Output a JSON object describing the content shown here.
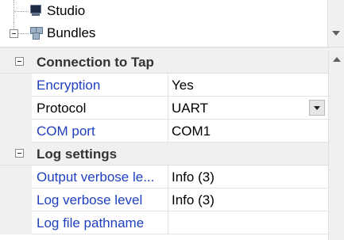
{
  "tree": {
    "items": [
      {
        "label": "Studio",
        "icon": "computer-icon"
      },
      {
        "label": "Bundles",
        "icon": "bundles-icon"
      }
    ]
  },
  "property_grid": {
    "categories": [
      {
        "label": "Connection to Tap",
        "properties": [
          {
            "name": "Encryption",
            "value": "Yes"
          },
          {
            "name": "Protocol",
            "value": "UART"
          },
          {
            "name": "COM port",
            "value": "COM1"
          }
        ]
      },
      {
        "label": "Log settings",
        "properties": [
          {
            "name": "Output verbose le...",
            "value": "Info (3)"
          },
          {
            "name": "Log verbose level",
            "value": "Info (3)"
          },
          {
            "name": "Log file pathname",
            "value": ""
          }
        ]
      }
    ]
  },
  "colors": {
    "property_name_link": "#1f3fbf",
    "category_background": "#f0f0f0"
  }
}
